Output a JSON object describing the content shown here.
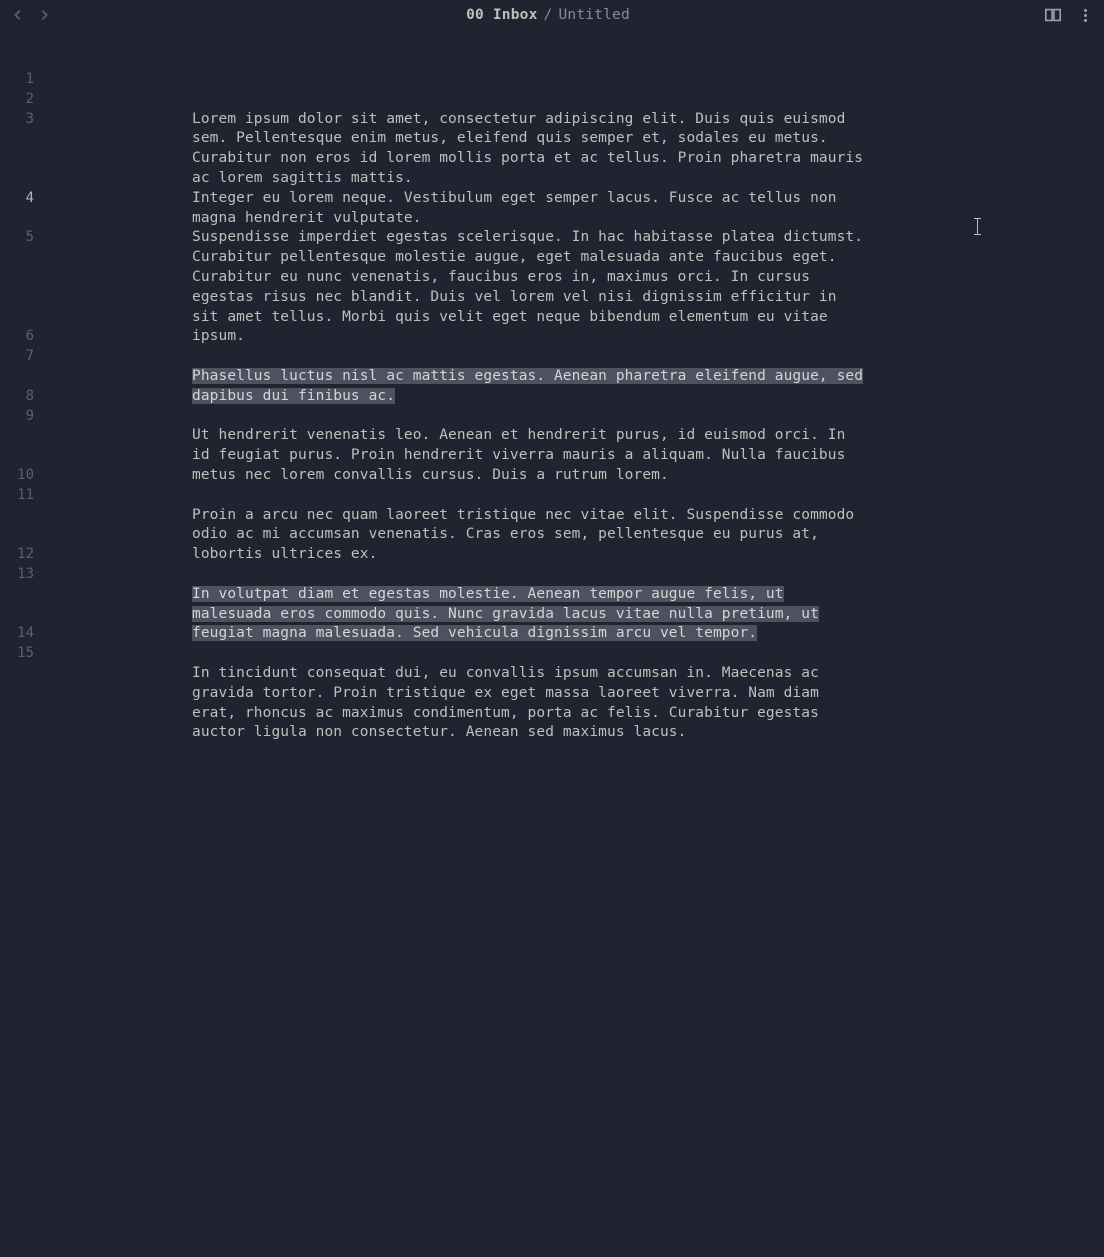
{
  "titlebar": {
    "folder": "00 Inbox",
    "separator": "/",
    "title": "Untitled"
  },
  "active_line": 4,
  "lines": [
    {
      "num": 1,
      "text": "",
      "highlight": false
    },
    {
      "num": 2,
      "text": "",
      "highlight": false
    },
    {
      "num": 3,
      "text": "Lorem ipsum dolor sit amet, consectetur adipiscing elit. Duis quis euismod sem. Pellentesque enim metus, eleifend quis semper et, sodales eu metus. Curabitur non eros id lorem mollis porta et ac tellus. Proin pharetra mauris ac lorem sagittis mattis.",
      "highlight": false
    },
    {
      "num": 4,
      "text": "Integer eu lorem neque. Vestibulum eget semper lacus. Fusce ac tellus non magna hendrerit vulputate.",
      "highlight": false
    },
    {
      "num": 5,
      "text": "Suspendisse imperdiet egestas scelerisque. In hac habitasse platea dictumst. Curabitur pellentesque molestie augue, eget malesuada ante faucibus eget. Curabitur eu nunc venenatis, faucibus eros in, maximus orci. In cursus egestas risus nec blandit. Duis vel lorem vel nisi dignissim efficitur in sit amet tellus. Morbi quis velit eget neque bibendum elementum eu vitae ipsum.",
      "highlight": false
    },
    {
      "num": 6,
      "text": "",
      "highlight": false
    },
    {
      "num": 7,
      "text": "Phasellus luctus nisl ac mattis egestas. Aenean pharetra eleifend augue, sed dapibus dui finibus ac.",
      "highlight": true
    },
    {
      "num": 8,
      "text": "",
      "highlight": false
    },
    {
      "num": 9,
      "text": "Ut hendrerit venenatis leo. Aenean et hendrerit purus, id euismod orci. In id feugiat purus. Proin hendrerit viverra mauris a aliquam. Nulla faucibus metus nec lorem convallis cursus. Duis a rutrum lorem.",
      "highlight": false
    },
    {
      "num": 10,
      "text": "",
      "highlight": false
    },
    {
      "num": 11,
      "text": "Proin a arcu nec quam laoreet tristique nec vitae elit. Suspendisse commodo odio ac mi accumsan venenatis. Cras eros sem, pellentesque eu purus at, lobortis ultrices ex.",
      "highlight": false
    },
    {
      "num": 12,
      "text": "",
      "highlight": false
    },
    {
      "num": 13,
      "text": "In volutpat diam et egestas molestie. Aenean tempor augue felis, ut malesuada eros commodo quis. Nunc gravida lacus vitae nulla pretium, ut feugiat magna malesuada. Sed vehicula dignissim arcu vel tempor.",
      "highlight": true
    },
    {
      "num": 14,
      "text": "",
      "highlight": false
    },
    {
      "num": 15,
      "text": "In tincidunt consequat dui, eu convallis ipsum accumsan in. Maecenas ac gravida tortor. Proin tristique ex eget massa laoreet viverra. Nam diam erat, rhoncus ac maximus condimentum, porta ac felis. Curabitur egestas auctor ligula non consectetur. Aenean sed maximus lacus.",
      "highlight": false
    }
  ],
  "visual_line_counts": [
    1,
    1,
    4,
    2,
    5,
    1,
    2,
    1,
    3,
    1,
    3,
    1,
    3,
    1,
    4
  ]
}
